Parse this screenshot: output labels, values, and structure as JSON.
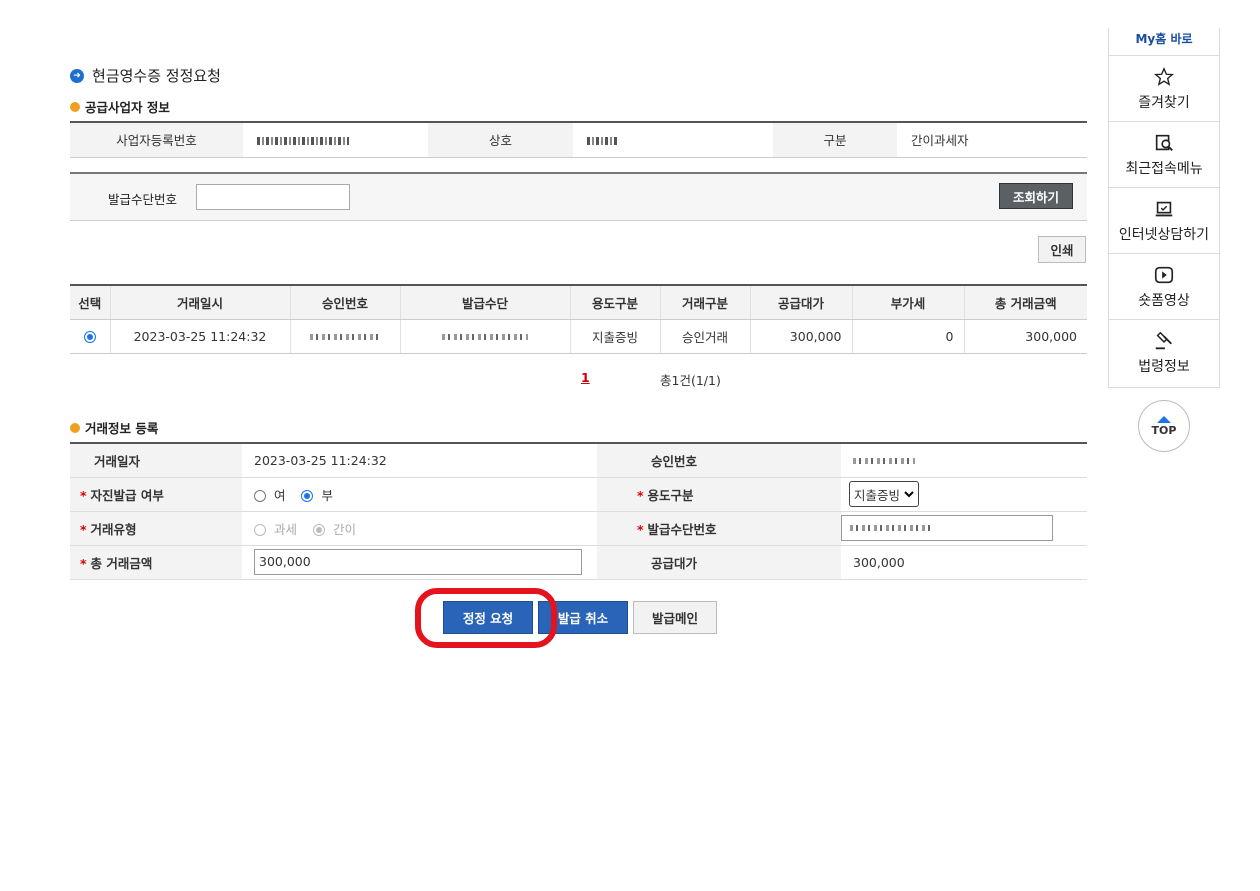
{
  "page": {
    "title": "현금영수증 정정요청"
  },
  "supplier": {
    "section_title": "공급사업자 정보",
    "biz_no_label": "사업자등록번호",
    "name_label": "상호",
    "type_label": "구분",
    "type_value": "간이과세자"
  },
  "search": {
    "label": "발급수단번호",
    "value": "",
    "button": "조회하기"
  },
  "print_button": "인쇄",
  "list": {
    "headers": [
      "선택",
      "거래일시",
      "승인번호",
      "발급수단",
      "용도구분",
      "거래구분",
      "공급대가",
      "부가세",
      "총 거래금액"
    ],
    "rows": [
      {
        "datetime": "2023-03-25 11:24:32",
        "usage": "지출증빙",
        "trade_type": "승인거래",
        "supply": "300,000",
        "vat": "0",
        "total": "300,000"
      }
    ]
  },
  "pagination": {
    "current": "1",
    "summary": "총1건(1/1)"
  },
  "trade": {
    "section_title": "거래정보 등록",
    "date_label": "거래일자",
    "date_value": "2023-03-25 11:24:32",
    "approval_label": "승인번호",
    "self_issue_label": "자진발급 여부",
    "self_issue_yes": "여",
    "self_issue_no": "부",
    "usage_label": "용도구분",
    "usage_value": "지출증빙",
    "trade_type_label": "거래유형",
    "trade_type_tax": "과세",
    "trade_type_simple": "간이",
    "issue_no_label": "발급수단번호",
    "total_label": "총 거래금액",
    "total_value": "300,000",
    "supply_label": "공급대가",
    "supply_value": "300,000",
    "required_mark": "*"
  },
  "buttons": {
    "correct": "정정 요청",
    "cancel": "발급 취소",
    "main": "발급메인"
  },
  "sidebar": {
    "top_label": "My홈 바로",
    "items": [
      {
        "label": "즐겨찾기",
        "icon": "star-icon"
      },
      {
        "label": "최근접속메뉴",
        "icon": "recent-menu-icon"
      },
      {
        "label": "인터넷상담하기",
        "icon": "laptop-icon"
      },
      {
        "label": "숏폼영상",
        "icon": "play-icon"
      },
      {
        "label": "법령정보",
        "icon": "gavel-icon"
      }
    ],
    "top_button": "TOP"
  },
  "colors": {
    "accent": "#2a64b8",
    "highlight": "#e3141e",
    "required": "#dd0000"
  }
}
